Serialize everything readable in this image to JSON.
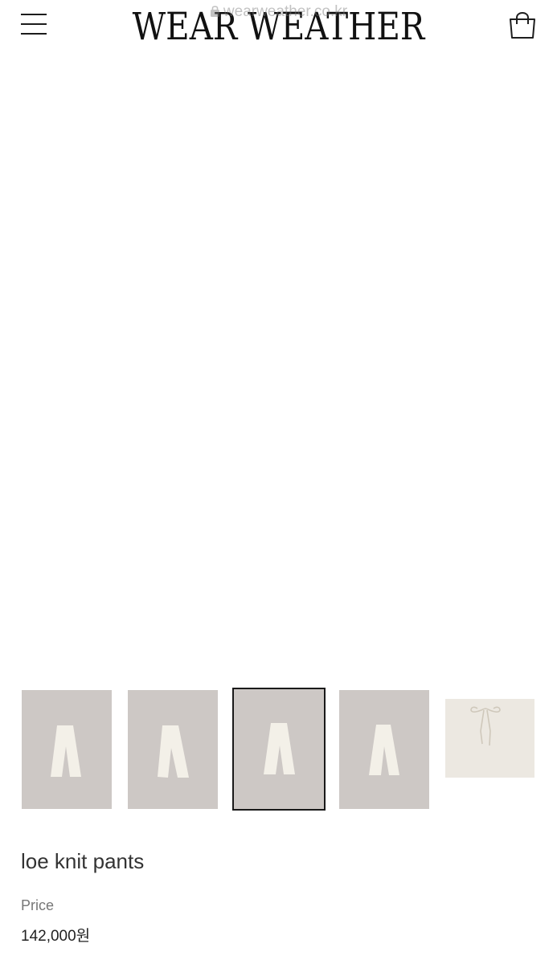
{
  "header": {
    "logo": "WEAR WEATHER",
    "url": "wearweather.co.kr",
    "menu_icon": "hamburger-menu-icon",
    "cart_icon": "shopping-bag-icon"
  },
  "gallery": {
    "background": "#cdc8c5",
    "product_color": "#f3f0e8",
    "prev_icon": "chevron-left-icon",
    "next_icon": "chevron-right-icon",
    "selected_thumbnail": 3,
    "thumbnail_count": 5
  },
  "product": {
    "name": "loe knit pants",
    "price_label": "Price",
    "price": "142,000원"
  }
}
